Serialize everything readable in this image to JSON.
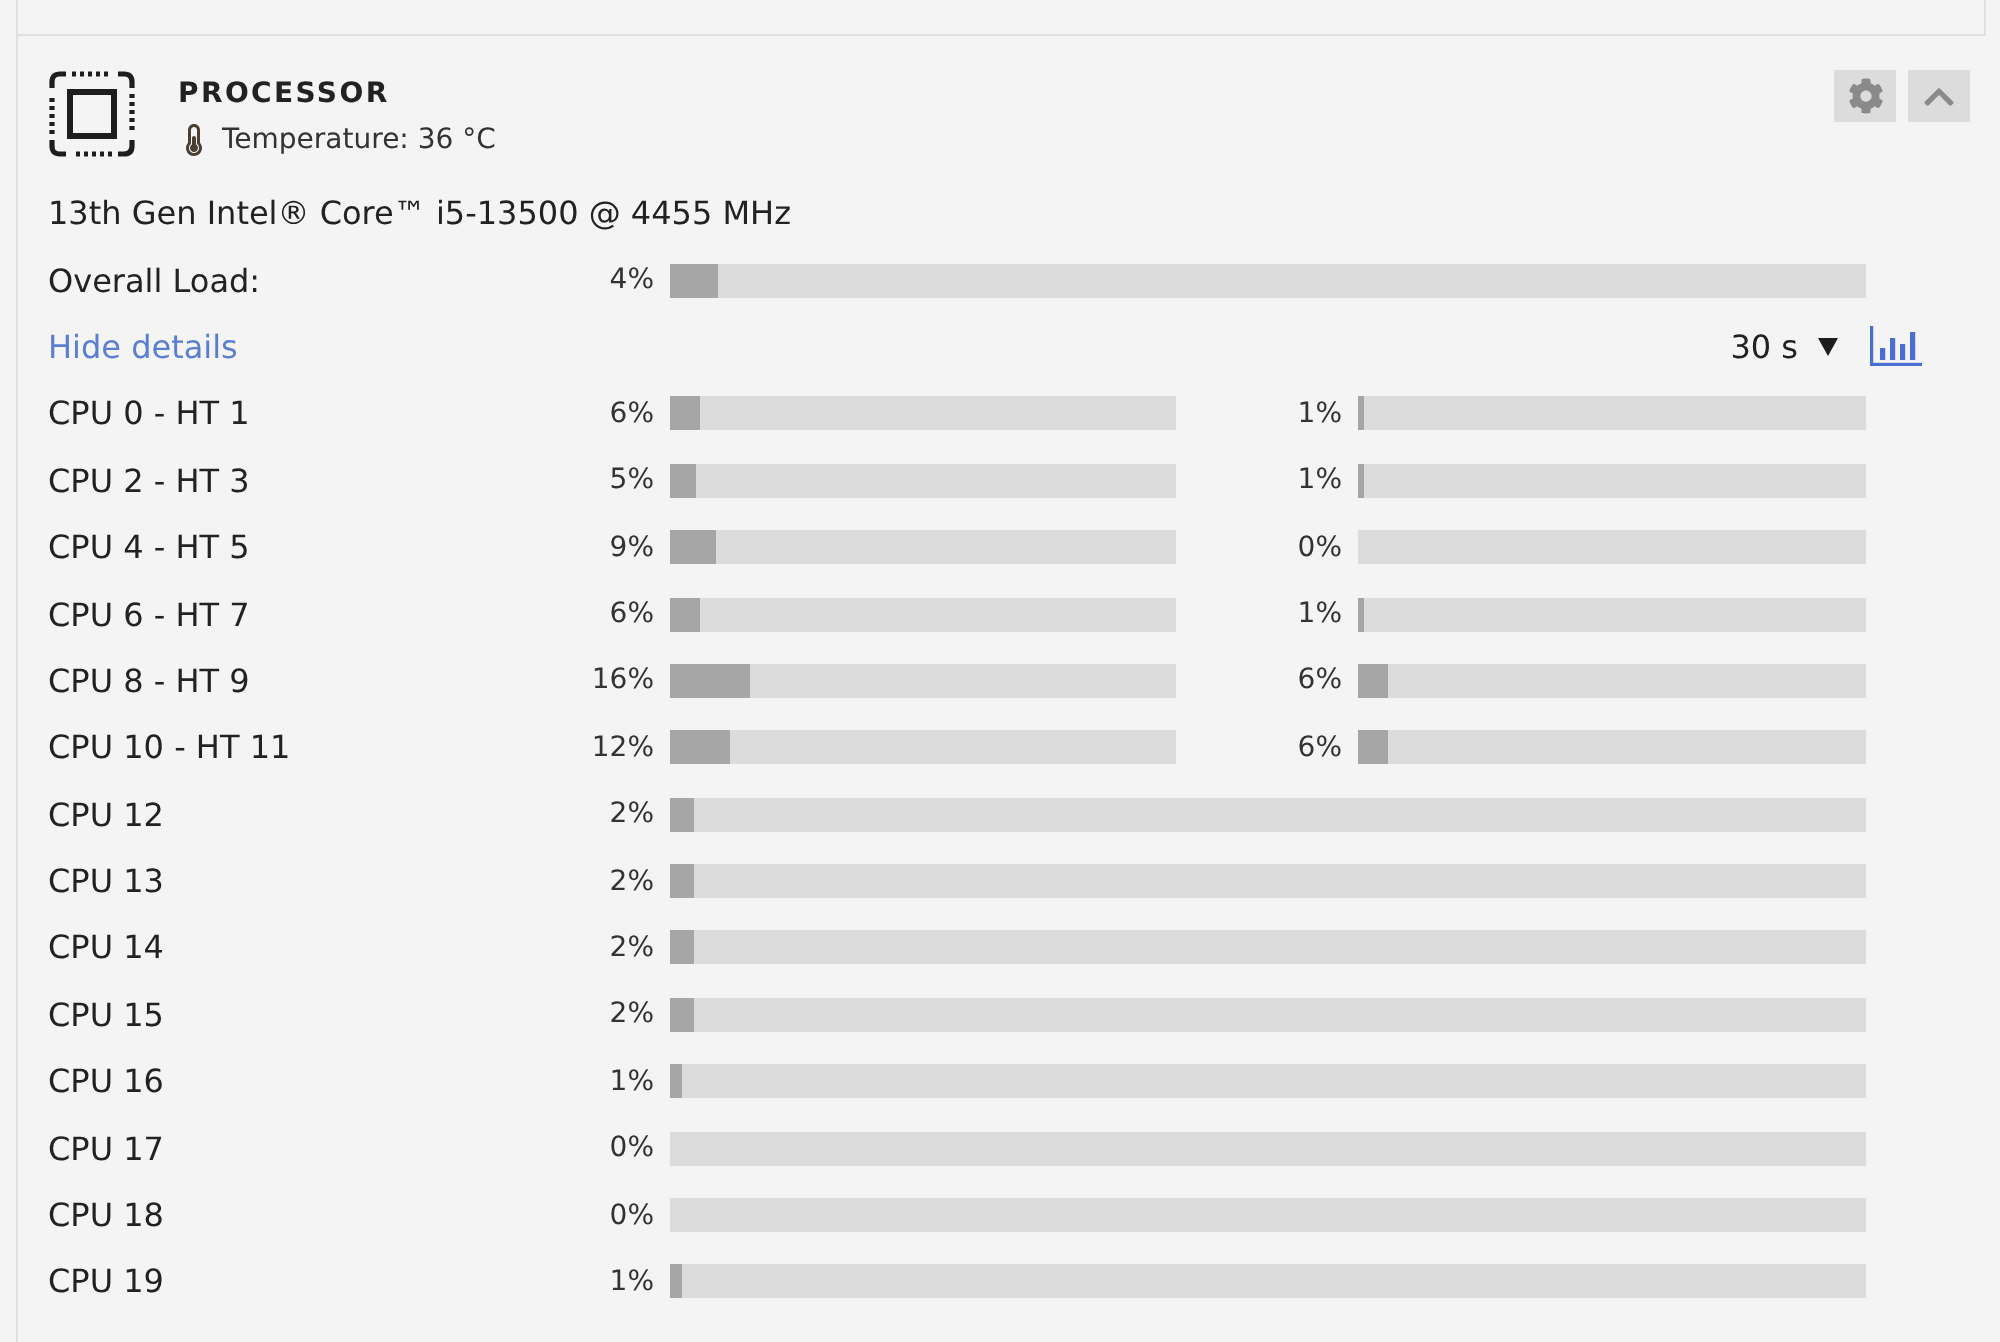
{
  "panel": {
    "title": "PROCESSOR",
    "temperature": "Temperature: 36 °C",
    "model": "13th Gen Intel® Core™ i5-13500 @ 4455 MHz"
  },
  "overall_load": {
    "label": "Overall Load:",
    "reading": "4%",
    "level": 0.04
  },
  "details_link": "Hide details",
  "interval": {
    "value": "30 s"
  },
  "cores": [
    {
      "kind": "pair",
      "name": "CPU 0 - HT 1",
      "loads": [
        {
          "reading": "6%",
          "level": 0.06
        },
        {
          "reading": "1%",
          "level": 0.01
        }
      ]
    },
    {
      "kind": "pair",
      "name": "CPU 2 - HT 3",
      "loads": [
        {
          "reading": "5%",
          "level": 0.05
        },
        {
          "reading": "1%",
          "level": 0.01
        }
      ]
    },
    {
      "kind": "pair",
      "name": "CPU 4 - HT 5",
      "loads": [
        {
          "reading": "9%",
          "level": 0.09
        },
        {
          "reading": "0%",
          "level": 0
        }
      ]
    },
    {
      "kind": "pair",
      "name": "CPU 6 - HT 7",
      "loads": [
        {
          "reading": "6%",
          "level": 0.06
        },
        {
          "reading": "1%",
          "level": 0.01
        }
      ]
    },
    {
      "kind": "pair",
      "name": "CPU 8 - HT 9",
      "loads": [
        {
          "reading": "16%",
          "level": 0.16
        },
        {
          "reading": "6%",
          "level": 0.06
        }
      ]
    },
    {
      "kind": "pair",
      "name": "CPU 10 - HT 11",
      "loads": [
        {
          "reading": "12%",
          "level": 0.12
        },
        {
          "reading": "6%",
          "level": 0.06
        }
      ]
    },
    {
      "kind": "single",
      "name": "CPU 12",
      "loads": [
        {
          "reading": "2%",
          "level": 0.02
        }
      ]
    },
    {
      "kind": "single",
      "name": "CPU 13",
      "loads": [
        {
          "reading": "2%",
          "level": 0.02
        }
      ]
    },
    {
      "kind": "single",
      "name": "CPU 14",
      "loads": [
        {
          "reading": "2%",
          "level": 0.02
        }
      ]
    },
    {
      "kind": "single",
      "name": "CPU 15",
      "loads": [
        {
          "reading": "2%",
          "level": 0.02
        }
      ]
    },
    {
      "kind": "single",
      "name": "CPU 16",
      "loads": [
        {
          "reading": "1%",
          "level": 0.01
        }
      ]
    },
    {
      "kind": "single",
      "name": "CPU 17",
      "loads": [
        {
          "reading": "0%",
          "level": 0
        }
      ]
    },
    {
      "kind": "single",
      "name": "CPU 18",
      "loads": [
        {
          "reading": "0%",
          "level": 0
        }
      ]
    },
    {
      "kind": "single",
      "name": "CPU 19",
      "loads": [
        {
          "reading": "1%",
          "level": 0.01
        }
      ]
    }
  ]
}
